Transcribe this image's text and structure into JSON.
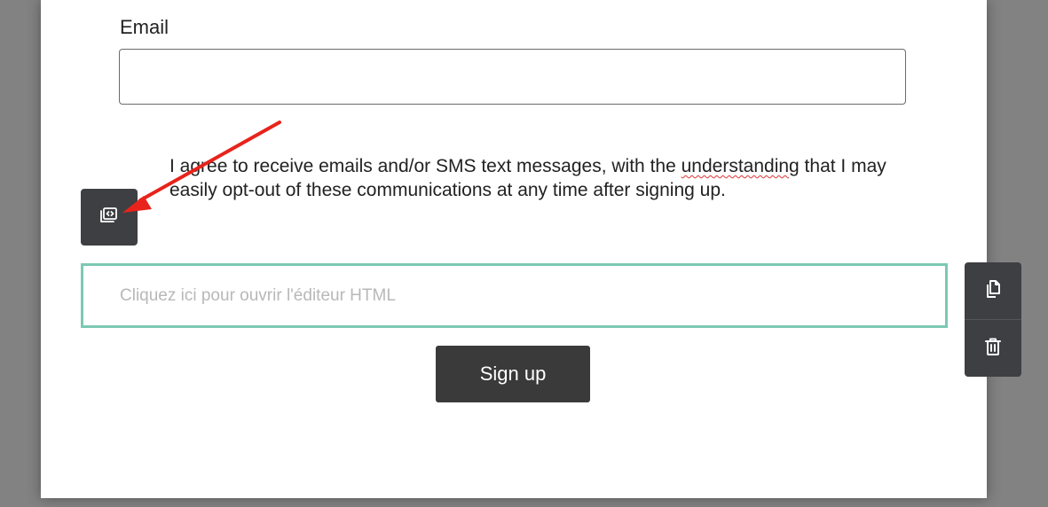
{
  "form": {
    "email_label": "Email",
    "email_value": "",
    "consent_part1": "I agree to receive emails and/or SMS text messages, with the ",
    "consent_underlined": "understandin",
    "consent_part2": "g that I may easily opt-out of these communications at any time after signing up.",
    "html_editor_placeholder": "Cliquez ici pour ouvrir l'éditeur HTML",
    "signup_label": "Sign up"
  },
  "widgets": {
    "side_icon": "code-block-icon",
    "duplicate_icon": "copy-icon",
    "delete_icon": "trash-icon"
  },
  "colors": {
    "selection_border": "#7cc9b3",
    "widget_bg": "#3e3f43",
    "button_bg": "#3a3a3a",
    "annotation_arrow": "#e8231b"
  }
}
